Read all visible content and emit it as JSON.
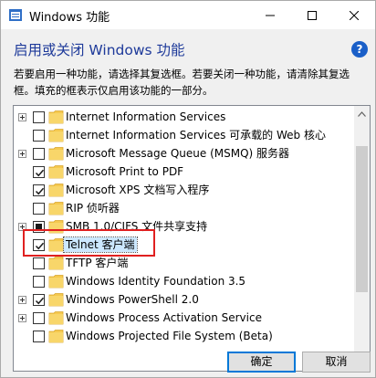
{
  "window": {
    "title": "Windows 功能"
  },
  "heading": "启用或关闭 Windows 功能",
  "help_label": "?",
  "description": "若要启用一种功能，请选择其复选框。若要关闭一种功能，请清除其复选框。填充的框表示仅启用该功能的一部分。",
  "features": [
    {
      "label": "Internet Information Services",
      "expandable": true,
      "state": "unchecked"
    },
    {
      "label": "Internet Information Services 可承载的 Web 核心",
      "expandable": false,
      "state": "unchecked"
    },
    {
      "label": "Microsoft Message Queue (MSMQ) 服务器",
      "expandable": true,
      "state": "unchecked"
    },
    {
      "label": "Microsoft Print to PDF",
      "expandable": false,
      "state": "checked"
    },
    {
      "label": "Microsoft XPS 文档写入程序",
      "expandable": false,
      "state": "checked"
    },
    {
      "label": "RIP 侦听器",
      "expandable": false,
      "state": "unchecked"
    },
    {
      "label": "SMB 1.0/CIFS 文件共享支持",
      "expandable": true,
      "state": "partial"
    },
    {
      "label": "Telnet 客户端",
      "expandable": false,
      "state": "checked",
      "selected": true
    },
    {
      "label": "TFTP 客户端",
      "expandable": false,
      "state": "unchecked"
    },
    {
      "label": "Windows Identity Foundation 3.5",
      "expandable": false,
      "state": "unchecked"
    },
    {
      "label": "Windows PowerShell 2.0",
      "expandable": true,
      "state": "checked"
    },
    {
      "label": "Windows Process Activation Service",
      "expandable": true,
      "state": "unchecked"
    },
    {
      "label": "Windows Projected File System (Beta)",
      "expandable": false,
      "state": "unchecked"
    }
  ],
  "buttons": {
    "ok": "确定",
    "cancel": "取消"
  },
  "colors": {
    "heading": "#1e3a9a",
    "highlight": "#e02020",
    "selection": "#cce8ff",
    "folder": "#f5c94f"
  }
}
